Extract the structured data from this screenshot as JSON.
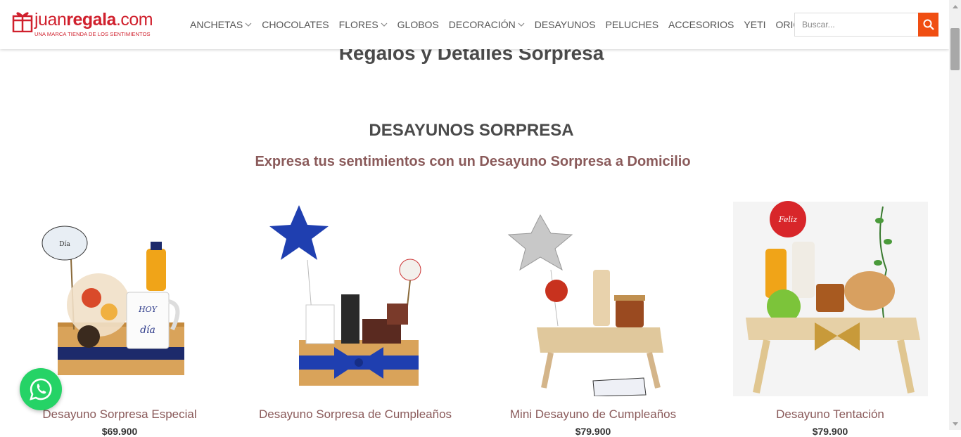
{
  "logo": {
    "text_light": "juan",
    "text_bold": "regala",
    "text_end": ".com",
    "tagline": "UNA MARCA TIENDA DE LOS SENTIMIENTOS"
  },
  "nav": {
    "items": [
      {
        "label": "ANCHETAS",
        "dropdown": true
      },
      {
        "label": "CHOCOLATES",
        "dropdown": false
      },
      {
        "label": "FLORES",
        "dropdown": true
      },
      {
        "label": "GLOBOS",
        "dropdown": false
      },
      {
        "label": "DECORACIÓN",
        "dropdown": true
      },
      {
        "label": "DESAYUNOS",
        "dropdown": false
      },
      {
        "label": "PELUCHES",
        "dropdown": false
      },
      {
        "label": "ACCESORIOS",
        "dropdown": false
      },
      {
        "label": "YETI",
        "dropdown": false
      },
      {
        "label": "ORIGINAL",
        "dropdown": true
      }
    ]
  },
  "search": {
    "placeholder": "Buscar...",
    "icon": "search-icon"
  },
  "page": {
    "top_title": "Regalos y Detalles Sorpresa",
    "section_title": "DESAYUNOS SORPRESA",
    "section_subtitle": "Expresa tus sentimientos con un  Desayuno Sorpresa a Domicilio"
  },
  "products": [
    {
      "name": "Desayuno Sorpresa Especial",
      "price": "$69.900"
    },
    {
      "name": "Desayuno Sorpresa de Cumpleaños",
      "price": ""
    },
    {
      "name": "Mini Desayuno de Cumpleaños",
      "price": "$79.900"
    },
    {
      "name": "Desayuno Tentación",
      "price": "$79.900"
    }
  ],
  "colors": {
    "brand_red": "#d0202d",
    "search_orange": "#f04e12",
    "whatsapp_green": "#25d366",
    "title_mauve": "#8a5a5a"
  },
  "whatsapp": {
    "icon": "whatsapp-icon"
  }
}
